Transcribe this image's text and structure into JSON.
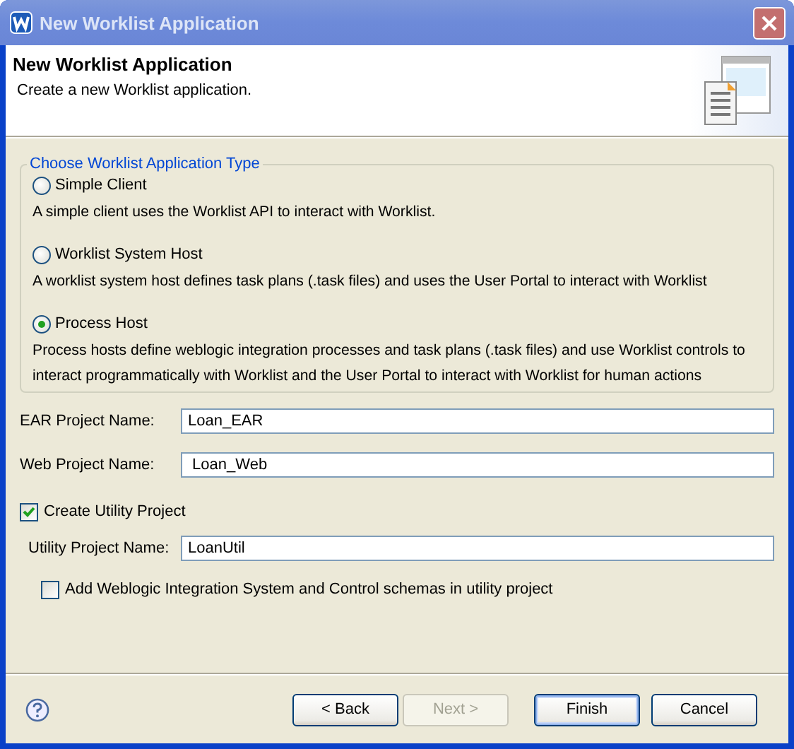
{
  "window": {
    "title": "New Worklist Application"
  },
  "header": {
    "title": "New Worklist Application",
    "description": "Create a new Worklist application."
  },
  "app_type": {
    "legend": "Choose Worklist Application Type",
    "options": [
      {
        "label": "Simple Client",
        "description": "A simple client uses the Worklist API to interact with Worklist.",
        "selected": false
      },
      {
        "label": "Worklist System Host",
        "description": "A worklist system host defines task plans (.task files) and uses the User Portal to interact with Worklist",
        "selected": false
      },
      {
        "label": "Process Host",
        "description": "Process hosts define weblogic integration processes and task plans (.task files) and use Worklist controls to interact programmatically with Worklist and the User Portal to interact with Worklist for human actions",
        "selected": true
      }
    ]
  },
  "fields": [
    {
      "label": "EAR Project Name:",
      "value": "Loan_EAR"
    },
    {
      "label": "Web Project Name:",
      "value": " Loan_Web"
    }
  ],
  "create_utility": {
    "label": "Create Utility Project",
    "checked": true
  },
  "utility_field": {
    "label": "Utility Project Name:",
    "value": "LoanUtil"
  },
  "add_schemas": {
    "label": "Add Weblogic Integration System and Control schemas in utility project",
    "checked": false
  },
  "buttons": [
    {
      "label": "< Back",
      "disabled": false,
      "default": false
    },
    {
      "label": "Next >",
      "disabled": true,
      "default": false
    },
    {
      "label": "Finish",
      "disabled": false,
      "default": true
    },
    {
      "label": "Cancel",
      "disabled": false,
      "default": false
    }
  ]
}
